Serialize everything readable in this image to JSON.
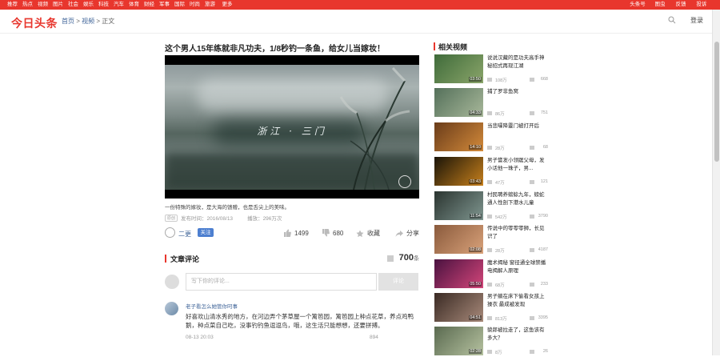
{
  "topnav": {
    "left": [
      "推荐",
      "热点",
      "视频",
      "图片",
      "社会",
      "娱乐",
      "科技",
      "汽车",
      "体育",
      "财经",
      "军事",
      "国际",
      "时尚",
      "旅游",
      "更多"
    ],
    "right": [
      "头条号",
      "图虫",
      "反馈",
      "投诉"
    ]
  },
  "header": {
    "logo": "今日头条",
    "crumb_home": "首页",
    "crumb_video": "视频",
    "crumb_current": "正文",
    "sep1": ">",
    "sep2": ">",
    "login": "登录"
  },
  "article": {
    "title": "这个男人15年练就非凡功夫，1/8秒钓一条鱼，给女儿当嫁妆！",
    "video_caption": "浙江 · 三门",
    "summary": "一份特殊的嫁妆，是大海的馈赠，也是舌尖上的美味。",
    "orig": "原创",
    "publish": "发布时间：2016/08/13",
    "plays": "播放：296万次",
    "author": "二更",
    "follow": "关注",
    "likes": "1499",
    "dislikes": "680",
    "collect": "收藏",
    "share": "分享"
  },
  "comments": {
    "header": "文章评论",
    "count": "700",
    "unit": "条",
    "placeholder": "写下你的评论...",
    "submit": "评论",
    "first": {
      "name": "老子看怎么她管你叼事",
      "text": "好喜欢山清水秀的地方，在河边弄个茅草屋一个篱笆园，篱笆园上种点花草，养点鸡鸭鹅，种点菜自己吃，没事钓钓鱼逗逗鸟，哦，这生活只能想想，还要拼搏。",
      "time": "08-13 20:03",
      "likes": "894"
    }
  },
  "related": {
    "header": "相关视频",
    "items": [
      {
        "title": "说说汉藏的是功夫高手神秘招式再现江湖",
        "duration": "03:50",
        "plays": "108万",
        "comments": "668"
      },
      {
        "title": "捕了罗非鱼窝",
        "duration": "04:33",
        "plays": "86万",
        "comments": "751"
      },
      {
        "title": "当悲嚯降靈门被打开后",
        "duration": "14:10",
        "plays": "28万",
        "comments": "68"
      },
      {
        "title": "男子嘗发小领踞父母，发小话他一珠子，男...",
        "duration": "03:43",
        "plays": "47万",
        "comments": "121"
      },
      {
        "title": "村民聘养螃蜍九年，螃蛇通人性剖下港水儿童",
        "duration": "11:54",
        "plays": "542万",
        "comments": "3790"
      },
      {
        "title": "传说中的零零零狮，长见识了",
        "duration": "02:08",
        "plays": "28万",
        "comments": "4187"
      },
      {
        "title": "魔术揭秘 窗径通全球禁播 电揭解人原理",
        "duration": "05:50",
        "plays": "68万",
        "comments": "233"
      },
      {
        "title": "男子躺在床下偷看女孩上操衣 最成被发现",
        "duration": "04:51",
        "plays": "813万",
        "comments": "3395"
      },
      {
        "title": "貌郎被拉走了，这鱼该有多大？",
        "duration": "02:28",
        "plays": "8万",
        "comments": "26"
      }
    ]
  },
  "colors": {
    "brand": "#e8362d",
    "link": "#406599",
    "follow": "#4d7fd0"
  }
}
